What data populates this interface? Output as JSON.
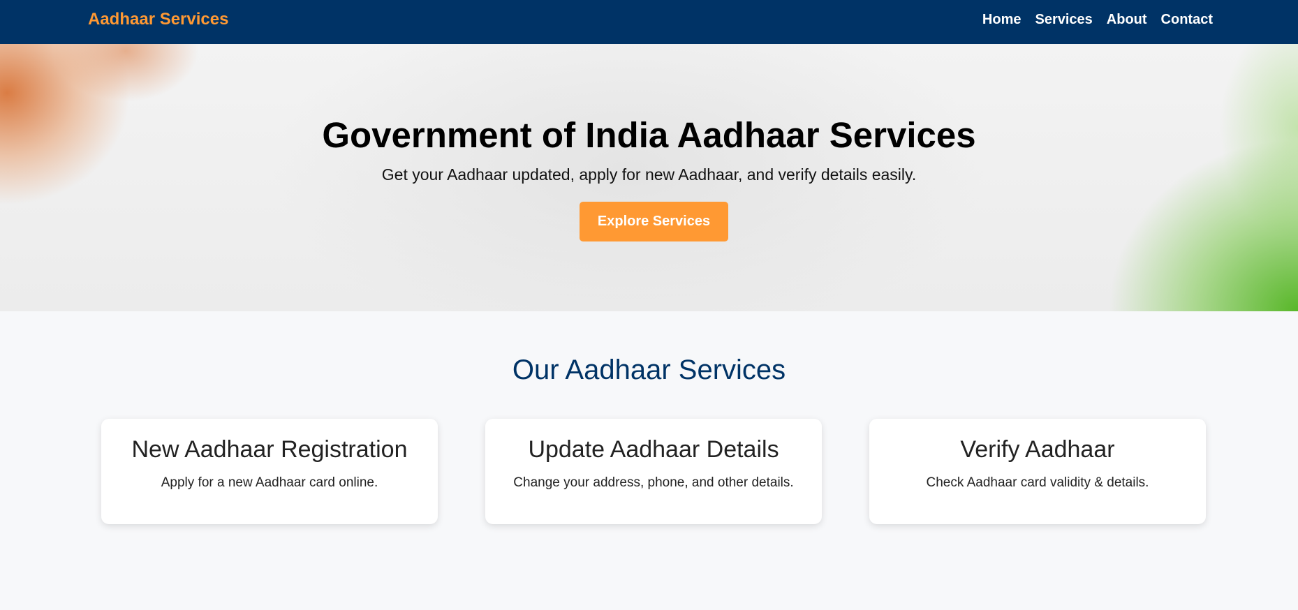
{
  "navbar": {
    "brand": "Aadhaar Services",
    "links": [
      "Home",
      "Services",
      "About",
      "Contact"
    ]
  },
  "hero": {
    "title": "Government of India Aadhaar Services",
    "subtitle": "Get your Aadhaar updated, apply for new Aadhaar, and verify details easily.",
    "button_label": "Explore Services"
  },
  "services": {
    "heading": "Our Aadhaar Services",
    "cards": [
      {
        "title": "New Aadhaar Registration",
        "description": "Apply for a new Aadhaar card online."
      },
      {
        "title": "Update Aadhaar Details",
        "description": "Change your address, phone, and other details."
      },
      {
        "title": "Verify Aadhaar",
        "description": "Check Aadhaar card validity & details."
      }
    ]
  },
  "colors": {
    "navbar_bg": "#003366",
    "accent": "#ff9933",
    "heading": "#003366"
  }
}
